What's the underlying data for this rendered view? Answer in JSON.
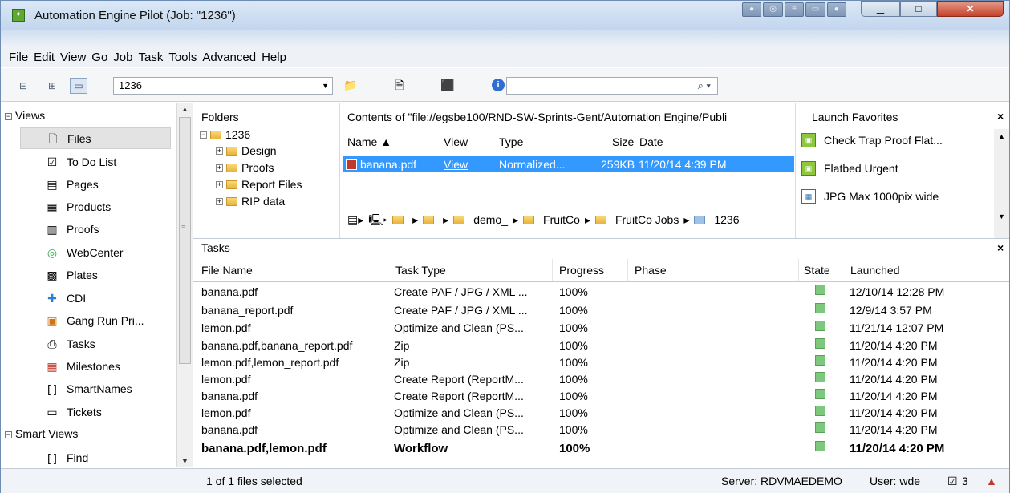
{
  "window": {
    "title": "Automation Engine Pilot (Job: \"1236\")"
  },
  "menu": [
    "File",
    "Edit",
    "View",
    "Go",
    "Job",
    "Task",
    "Tools",
    "Advanced",
    "Help"
  ],
  "toolbar": {
    "job_value": "1236",
    "search_value": "",
    "search_icon": "search-icon",
    "info_icon": "info-icon"
  },
  "sidebar": {
    "views_label": "Views",
    "items": [
      {
        "label": "Files",
        "icon": "file-icon"
      },
      {
        "label": "To Do List",
        "icon": "todo-icon"
      },
      {
        "label": "Pages",
        "icon": "pages-icon"
      },
      {
        "label": "Products",
        "icon": "products-icon"
      },
      {
        "label": "Proofs",
        "icon": "proofs-icon"
      },
      {
        "label": "WebCenter",
        "icon": "webcenter-icon"
      },
      {
        "label": "Plates",
        "icon": "plates-icon"
      },
      {
        "label": "CDI",
        "icon": "cdi-icon"
      },
      {
        "label": "Gang Run Pri...",
        "icon": "gangrun-icon"
      },
      {
        "label": "Tasks",
        "icon": "tasks-icon"
      },
      {
        "label": "Milestones",
        "icon": "milestones-icon"
      },
      {
        "label": "SmartNames",
        "icon": "smartnames-icon"
      },
      {
        "label": "Tickets",
        "icon": "tickets-icon"
      }
    ],
    "smart_views_label": "Smart Views",
    "find_label": "Find"
  },
  "folders": {
    "header": "Folders",
    "root": "1236",
    "children": [
      "Design",
      "Proofs",
      "Report Files",
      "RIP data"
    ]
  },
  "contents": {
    "header": "Contents of \"file://egsbe100/RND-SW-Sprints-Gent/Automation Engine/Publi",
    "columns": {
      "name": "Name ▲",
      "view": "View",
      "type": "Type",
      "size": "Size",
      "date": "Date"
    },
    "row": {
      "name": "banana.pdf",
      "view": "View",
      "type": "Normalized...",
      "size": "259KB",
      "date": "11/20/14 4:39 PM"
    },
    "path": [
      "demo_",
      "FruitCo",
      "FruitCo Jobs",
      "1236"
    ]
  },
  "favorites": {
    "header": "Launch Favorites",
    "items": [
      "Check Trap Proof Flat...",
      "Flatbed Urgent",
      "JPG Max 1000pix wide"
    ]
  },
  "tasks": {
    "header": "Tasks",
    "columns": {
      "file": "File Name",
      "type": "Task Type",
      "progress": "Progress",
      "phase": "Phase",
      "state": "State",
      "launched": "Launched"
    },
    "rows": [
      {
        "file": "banana.pdf",
        "type": "Create PAF / JPG / XML ...",
        "progress": "100%",
        "launched": "12/10/14 12:28 PM"
      },
      {
        "file": "banana_report.pdf",
        "type": "Create PAF / JPG / XML ...",
        "progress": "100%",
        "launched": "12/9/14 3:57 PM"
      },
      {
        "file": "lemon.pdf",
        "type": "Optimize and Clean (PS...",
        "progress": "100%",
        "launched": "11/21/14 12:07 PM"
      },
      {
        "file": "banana.pdf,banana_report.pdf",
        "type": "Zip",
        "progress": "100%",
        "launched": "11/20/14 4:20 PM"
      },
      {
        "file": "lemon.pdf,lemon_report.pdf",
        "type": "Zip",
        "progress": "100%",
        "launched": "11/20/14 4:20 PM"
      },
      {
        "file": "lemon.pdf",
        "type": "Create Report (ReportM...",
        "progress": "100%",
        "launched": "11/20/14 4:20 PM"
      },
      {
        "file": "banana.pdf",
        "type": "Create Report (ReportM...",
        "progress": "100%",
        "launched": "11/20/14 4:20 PM"
      },
      {
        "file": "lemon.pdf",
        "type": "Optimize and Clean (PS...",
        "progress": "100%",
        "launched": "11/20/14 4:20 PM"
      },
      {
        "file": "banana.pdf",
        "type": "Optimize and Clean (PS...",
        "progress": "100%",
        "launched": "11/20/14 4:20 PM"
      },
      {
        "file": "banana.pdf,lemon.pdf",
        "type": "Workflow",
        "progress": "100%",
        "launched": "11/20/14 4:20 PM"
      }
    ]
  },
  "status": {
    "selection": "1 of 1 files selected",
    "server": "Server: RDVMAEDEMO",
    "user": "User: wde",
    "todo_count": "3"
  }
}
